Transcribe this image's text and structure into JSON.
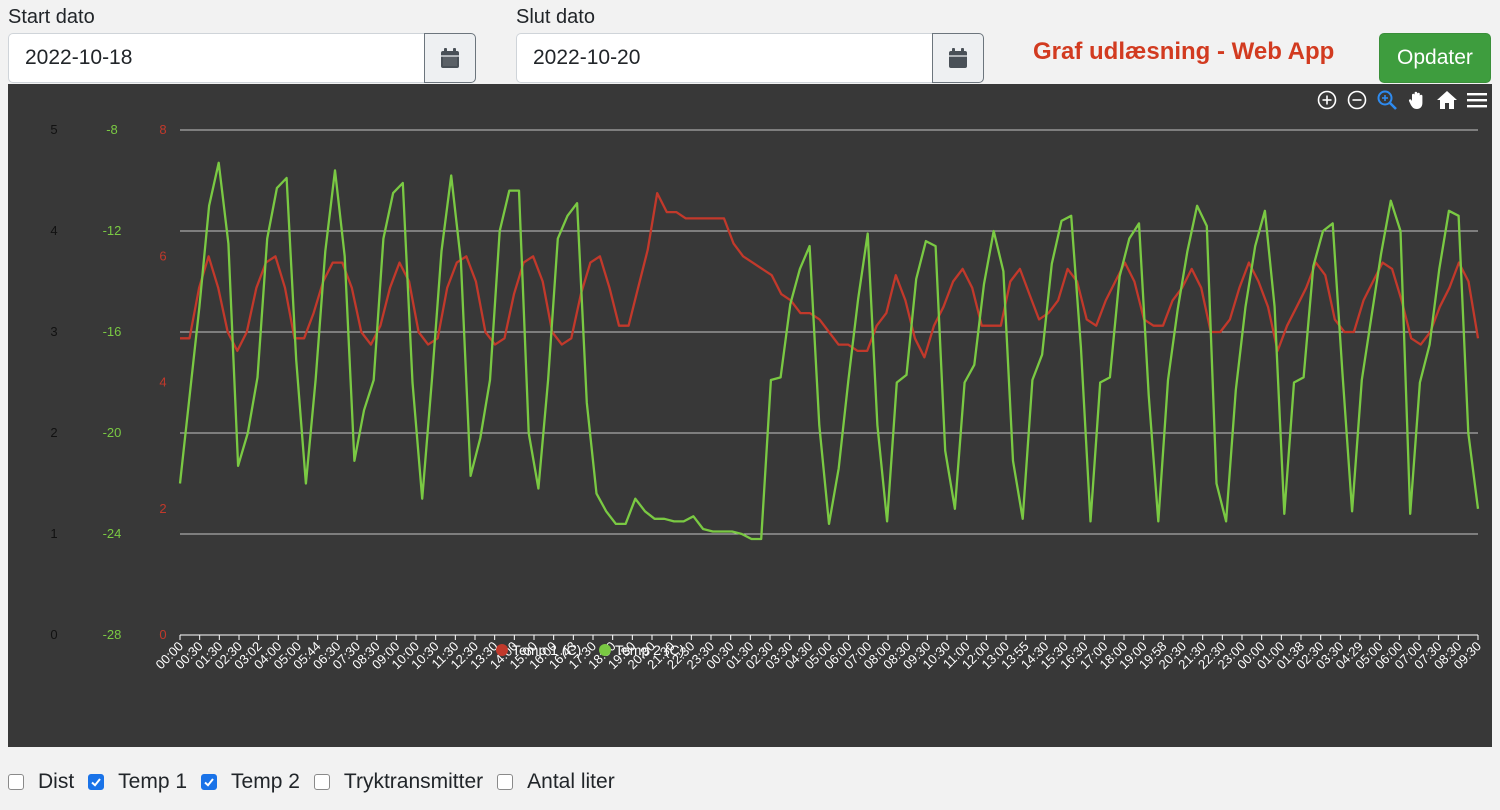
{
  "form": {
    "start_label": "Start dato",
    "start_value": "2022-10-18",
    "end_label": "Slut dato",
    "end_value": "2022-10-20",
    "title": "Graf udlæsning - Web App",
    "update_label": "Opdater"
  },
  "colors": {
    "temp1": "#c2392b",
    "temp2": "#7ac943",
    "axis_dist": "#111111",
    "grid": "#dddddd"
  },
  "toolbar_icons": [
    "zoom-in-icon",
    "zoom-out-icon",
    "zoom-select-icon",
    "pan-icon",
    "home-icon",
    "menu-icon"
  ],
  "checkboxes": [
    {
      "label": "Dist",
      "checked": false
    },
    {
      "label": "Temp 1",
      "checked": true
    },
    {
      "label": "Temp 2",
      "checked": true
    },
    {
      "label": "Tryktransmitter",
      "checked": false
    },
    {
      "label": "Antal liter",
      "checked": false
    }
  ],
  "chart_data": {
    "type": "line",
    "axes": {
      "dist": {
        "ticks": [
          "5",
          "4",
          "3",
          "2",
          "1",
          "0"
        ],
        "range": [
          0,
          5
        ]
      },
      "temp2": {
        "ticks": [
          "-8",
          "-12",
          "-16",
          "-20",
          "-24",
          "-28"
        ],
        "range": [
          -28,
          -8
        ]
      },
      "temp1": {
        "ticks": [
          "8",
          "6",
          "4",
          "2",
          "0"
        ],
        "range": [
          0,
          8
        ]
      }
    },
    "x_labels": [
      "00:00",
      "00:30",
      "01:30",
      "02:30",
      "03:02",
      "04:00",
      "05:00",
      "05:44",
      "06:30",
      "07:30",
      "08:30",
      "09:00",
      "10:00",
      "10:30",
      "11:30",
      "12:30",
      "13:30",
      "14:00",
      "15:00",
      "16:00",
      "16:43",
      "17:30",
      "18:30",
      "19:30",
      "20:30",
      "21:30",
      "22:30",
      "23:30",
      "00:30",
      "01:30",
      "02:30",
      "03:30",
      "04:30",
      "05:00",
      "06:00",
      "07:00",
      "08:00",
      "08:30",
      "09:30",
      "10:30",
      "11:00",
      "12:00",
      "13:00",
      "13:55",
      "14:30",
      "15:30",
      "16:30",
      "17:00",
      "18:00",
      "19:00",
      "19:58",
      "20:30",
      "21:30",
      "22:30",
      "23:00",
      "00:00",
      "01:00",
      "01:38",
      "02:30",
      "03:30",
      "04:29",
      "05:00",
      "06:00",
      "07:00",
      "07:30",
      "08:30",
      "09:30"
    ],
    "legend": [
      {
        "name": "Temp 1 (C)",
        "visible": true
      },
      {
        "name": "Temp 2 (C)",
        "visible": true
      }
    ],
    "legend_position": "bottom",
    "grid": true,
    "series": [
      {
        "name": "Temp 1 (C)",
        "axis": "temp1",
        "values": [
          4.7,
          4.7,
          5.5,
          6.0,
          5.5,
          4.8,
          4.5,
          4.8,
          5.5,
          5.9,
          6.0,
          5.5,
          4.7,
          4.7,
          5.1,
          5.6,
          5.9,
          5.9,
          5.5,
          4.8,
          4.6,
          4.9,
          5.5,
          5.9,
          5.6,
          4.8,
          4.6,
          4.7,
          5.5,
          5.9,
          6.0,
          5.6,
          4.8,
          4.6,
          4.7,
          5.4,
          5.9,
          6.0,
          5.6,
          4.8,
          4.6,
          4.7,
          5.4,
          5.9,
          6.0,
          5.5,
          4.9,
          4.9,
          5.5,
          6.1,
          7.0,
          6.7,
          6.7,
          6.6,
          6.6,
          6.6,
          6.6,
          6.6,
          6.2,
          6.0,
          5.9,
          5.8,
          5.7,
          5.4,
          5.3,
          5.1,
          5.1,
          5.0,
          4.8,
          4.6,
          4.6,
          4.5,
          4.5,
          4.9,
          5.1,
          5.7,
          5.3,
          4.7,
          4.4,
          4.9,
          5.2,
          5.6,
          5.8,
          5.5,
          4.9,
          4.9,
          4.9,
          5.6,
          5.8,
          5.4,
          5.0,
          5.1,
          5.3,
          5.8,
          5.6,
          5.0,
          4.9,
          5.3,
          5.6,
          5.9,
          5.6,
          5.0,
          4.9,
          4.9,
          5.3,
          5.5,
          5.8,
          5.5,
          4.8,
          4.8,
          5.0,
          5.5,
          5.9,
          5.6,
          5.2,
          4.5,
          4.9,
          5.2,
          5.5,
          5.9,
          5.7,
          5.0,
          4.8,
          4.8,
          5.3,
          5.6,
          5.9,
          5.8,
          5.3,
          4.7,
          4.6,
          4.8,
          5.2,
          5.5,
          5.9,
          5.6,
          4.7
        ]
      },
      {
        "name": "Temp 2 (C)",
        "axis": "temp2",
        "values": [
          -22.0,
          -18.5,
          -15.0,
          -11.0,
          -9.3,
          -12.5,
          -21.3,
          -20.0,
          -17.8,
          -12.3,
          -10.3,
          -9.9,
          -17.1,
          -22.0,
          -17.9,
          -12.8,
          -9.6,
          -13.0,
          -21.1,
          -19.1,
          -17.9,
          -12.3,
          -10.5,
          -10.1,
          -18.0,
          -22.6,
          -17.9,
          -12.8,
          -9.8,
          -13.2,
          -21.7,
          -20.2,
          -17.9,
          -12.0,
          -10.4,
          -10.4,
          -20.0,
          -22.2,
          -17.9,
          -12.3,
          -11.4,
          -10.9,
          -18.8,
          -22.4,
          -23.1,
          -23.6,
          -23.6,
          -22.6,
          -23.1,
          -23.4,
          -23.4,
          -23.5,
          -23.5,
          -23.3,
          -23.8,
          -23.9,
          -23.9,
          -23.9,
          -24.0,
          -24.2,
          -24.2,
          -17.9,
          -17.8,
          -14.9,
          -13.5,
          -12.6,
          -19.7,
          -23.6,
          -21.4,
          -17.9,
          -14.7,
          -12.1,
          -19.7,
          -23.5,
          -18.0,
          -17.7,
          -13.9,
          -12.4,
          -12.6,
          -20.7,
          -23.0,
          -18.0,
          -17.3,
          -14.1,
          -12.0,
          -13.6,
          -21.1,
          -23.4,
          -17.9,
          -16.9,
          -13.3,
          -11.6,
          -11.4,
          -16.6,
          -23.5,
          -18.0,
          -17.8,
          -13.8,
          -12.3,
          -11.7,
          -18.5,
          -23.5,
          -17.9,
          -15.1,
          -12.8,
          -11.0,
          -11.8,
          -22.0,
          -23.5,
          -18.3,
          -15.0,
          -12.6,
          -11.2,
          -15.0,
          -23.2,
          -18.0,
          -17.8,
          -13.4,
          -12.0,
          -11.7,
          -17.6,
          -23.1,
          -17.9,
          -15.4,
          -12.9,
          -10.8,
          -12.0,
          -23.2,
          -18.0,
          -16.5,
          -13.5,
          -11.2,
          -11.4,
          -20.0,
          -23.0
        ]
      }
    ]
  }
}
